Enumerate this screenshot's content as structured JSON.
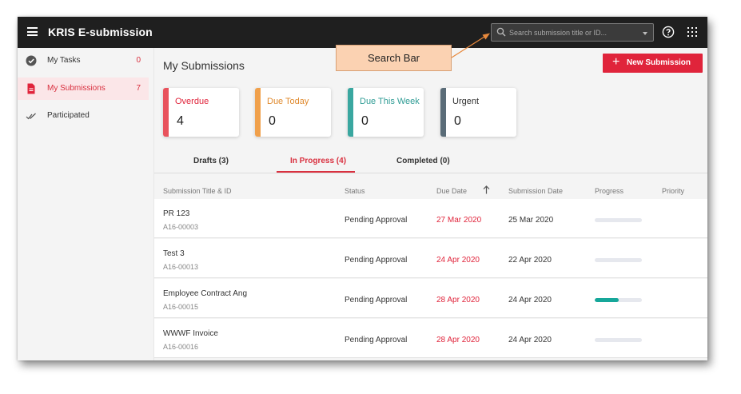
{
  "app": {
    "title": "KRIS E-submission"
  },
  "search": {
    "placeholder": "Search submission title or ID..."
  },
  "sidebar": {
    "items": [
      {
        "label": "My Tasks",
        "count": "0",
        "icon": "check-circle-icon"
      },
      {
        "label": "My Submissions",
        "count": "7",
        "icon": "document-icon",
        "active": true
      },
      {
        "label": "Participated",
        "count": "",
        "icon": "double-check-icon"
      }
    ]
  },
  "main": {
    "title": "My Submissions",
    "new_button": {
      "plus": "+",
      "label": "New Submission"
    },
    "cards": [
      {
        "title": "Overdue",
        "value": "4",
        "color": "#e8525c"
      },
      {
        "title": "Due Today",
        "value": "0",
        "color": "#f0a04b"
      },
      {
        "title": "Due This Week",
        "value": "0",
        "color": "#3aa7a0"
      },
      {
        "title": "Urgent",
        "value": "0",
        "color": "#5a6c78"
      }
    ],
    "tabs": [
      {
        "label": "Drafts (3)"
      },
      {
        "label": "In Progress (4)",
        "active": true
      },
      {
        "label": "Completed (0)"
      }
    ],
    "table": {
      "columns": [
        "Submission Title & ID",
        "Status",
        "Due Date",
        "Submission Date",
        "Progress",
        "Priority"
      ],
      "rows": [
        {
          "title": "PR 123",
          "id": "A16-00003",
          "status": "Pending Approval",
          "due": "27 Mar 2020",
          "submitted": "25 Mar 2020",
          "progress": 0
        },
        {
          "title": "Test 3",
          "id": "A16-00013",
          "status": "Pending Approval",
          "due": "24 Apr 2020",
          "submitted": "22 Apr 2020",
          "progress": 0
        },
        {
          "title": "Employee Contract Ang",
          "id": "A16-00015",
          "status": "Pending Approval",
          "due": "28 Apr 2020",
          "submitted": "24 Apr 2020",
          "progress": 0.5
        },
        {
          "title": "WWWF Invoice",
          "id": "A16-00016",
          "status": "Pending Approval",
          "due": "28 Apr 2020",
          "submitted": "24 Apr 2020",
          "progress": 0
        }
      ]
    }
  },
  "callout": {
    "text": "Search Bar"
  },
  "colors": {
    "accent": "#e0243b",
    "topbar": "#1f1f1f",
    "progress": "#16a79a"
  }
}
